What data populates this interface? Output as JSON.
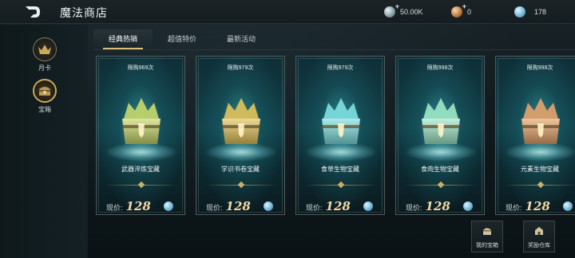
{
  "header": {
    "title": "魔法商店",
    "currencies": [
      {
        "icon": "silver-coin-icon",
        "value": "50.00K",
        "has_plus": true
      },
      {
        "icon": "bronze-coin-icon",
        "value": "0",
        "has_plus": true
      },
      {
        "icon": "crystal-coin-icon",
        "value": "178",
        "has_plus": false
      }
    ]
  },
  "sidebar": {
    "items": [
      {
        "label": "月卡",
        "icon": "crown-icon",
        "active": false
      },
      {
        "label": "宝箱",
        "icon": "treasure-chest-icon",
        "active": true
      }
    ]
  },
  "tabs": [
    {
      "label": "经典热销",
      "active": true
    },
    {
      "label": "超值特价",
      "active": false
    },
    {
      "label": "最新活动",
      "active": false
    }
  ],
  "cards": [
    {
      "limit": "限购969次",
      "name": "武器淬炼宝藏",
      "price_label": "现价:",
      "price": "128",
      "accent": "#c9d86a"
    },
    {
      "limit": "限购979次",
      "name": "学识书卷宝藏",
      "price_label": "现价:",
      "price": "128",
      "accent": "#e4c35a"
    },
    {
      "limit": "限购979次",
      "name": "食草生物宝藏",
      "price_label": "现价:",
      "price": "128",
      "accent": "#7fe0e0"
    },
    {
      "limit": "限购998次",
      "name": "食肉生物宝藏",
      "price_label": "现价:",
      "price": "128",
      "accent": "#9fe8c8"
    },
    {
      "limit": "限购998次",
      "name": "元素生物宝藏",
      "price_label": "现价:",
      "price": "128",
      "accent": "#e6a36a"
    }
  ],
  "bottom_buttons": [
    {
      "label": "我的宝箱",
      "icon": "chest-icon"
    },
    {
      "label": "奖励仓库",
      "icon": "warehouse-icon"
    }
  ],
  "colors": {
    "accent_gold": "#d9c077",
    "price_gold": "#f2d8a6",
    "card_teal": "#114049"
  }
}
